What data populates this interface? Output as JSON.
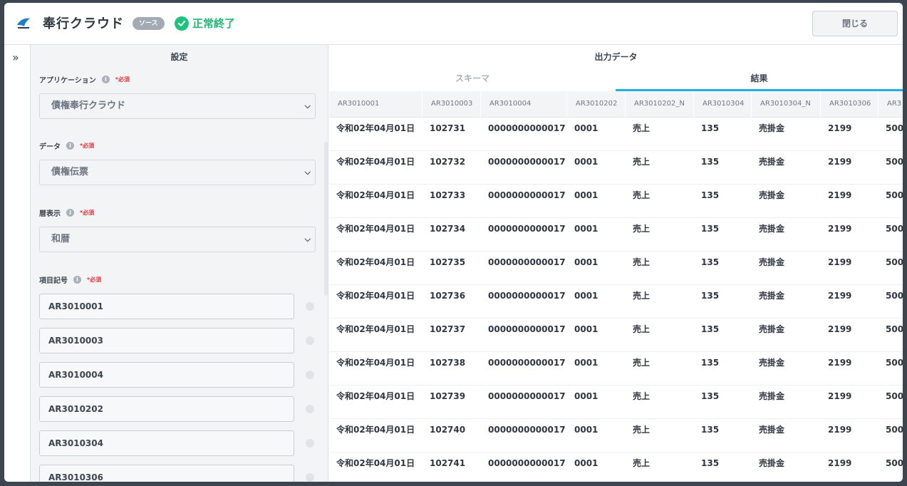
{
  "header": {
    "app_title": "奉行クラウド",
    "badge": "ソース",
    "status": "正常終了",
    "close_label": "閉じる"
  },
  "settings": {
    "title": "設定",
    "required_mark": "*必須",
    "application": {
      "label": "アプリケーション",
      "value": "債権奉行クラウド"
    },
    "data": {
      "label": "データ",
      "value": "債権伝票"
    },
    "calendar": {
      "label": "暦表示",
      "value": "和暦"
    },
    "item_codes": {
      "label": "項目記号",
      "values": [
        "AR3010001",
        "AR3010003",
        "AR3010004",
        "AR3010202",
        "AR3010304",
        "AR3010306"
      ]
    }
  },
  "output": {
    "title": "出力データ",
    "tabs": [
      {
        "label": "スキーマ",
        "active": false
      },
      {
        "label": "結果",
        "active": true
      }
    ],
    "columns": [
      "AR3010001",
      "AR3010003",
      "AR3010004",
      "AR3010202",
      "AR3010202_N",
      "AR3010304",
      "AR3010304_N",
      "AR3010306",
      "AR3"
    ],
    "rows": [
      [
        "令和02年04月01日",
        "102731",
        "0000000000017",
        "0001",
        "売上",
        "135",
        "売掛金",
        "2199",
        "500"
      ],
      [
        "令和02年04月01日",
        "102732",
        "0000000000017",
        "0001",
        "売上",
        "135",
        "売掛金",
        "2199",
        "500"
      ],
      [
        "令和02年04月01日",
        "102733",
        "0000000000017",
        "0001",
        "売上",
        "135",
        "売掛金",
        "2199",
        "500"
      ],
      [
        "令和02年04月01日",
        "102734",
        "0000000000017",
        "0001",
        "売上",
        "135",
        "売掛金",
        "2199",
        "500"
      ],
      [
        "令和02年04月01日",
        "102735",
        "0000000000017",
        "0001",
        "売上",
        "135",
        "売掛金",
        "2199",
        "500"
      ],
      [
        "令和02年04月01日",
        "102736",
        "0000000000017",
        "0001",
        "売上",
        "135",
        "売掛金",
        "2199",
        "500"
      ],
      [
        "令和02年04月01日",
        "102737",
        "0000000000017",
        "0001",
        "売上",
        "135",
        "売掛金",
        "2199",
        "500"
      ],
      [
        "令和02年04月01日",
        "102738",
        "0000000000017",
        "0001",
        "売上",
        "135",
        "売掛金",
        "2199",
        "500"
      ],
      [
        "令和02年04月01日",
        "102739",
        "0000000000017",
        "0001",
        "売上",
        "135",
        "売掛金",
        "2199",
        "500"
      ],
      [
        "令和02年04月01日",
        "102740",
        "0000000000017",
        "0001",
        "売上",
        "135",
        "売掛金",
        "2199",
        "500"
      ],
      [
        "令和02年04月01日",
        "102741",
        "0000000000017",
        "0001",
        "売上",
        "135",
        "売掛金",
        "2199",
        "500"
      ]
    ]
  },
  "colors": {
    "accent": "#1bb3e0",
    "success": "#1fc27a",
    "required": "#e0343a"
  }
}
